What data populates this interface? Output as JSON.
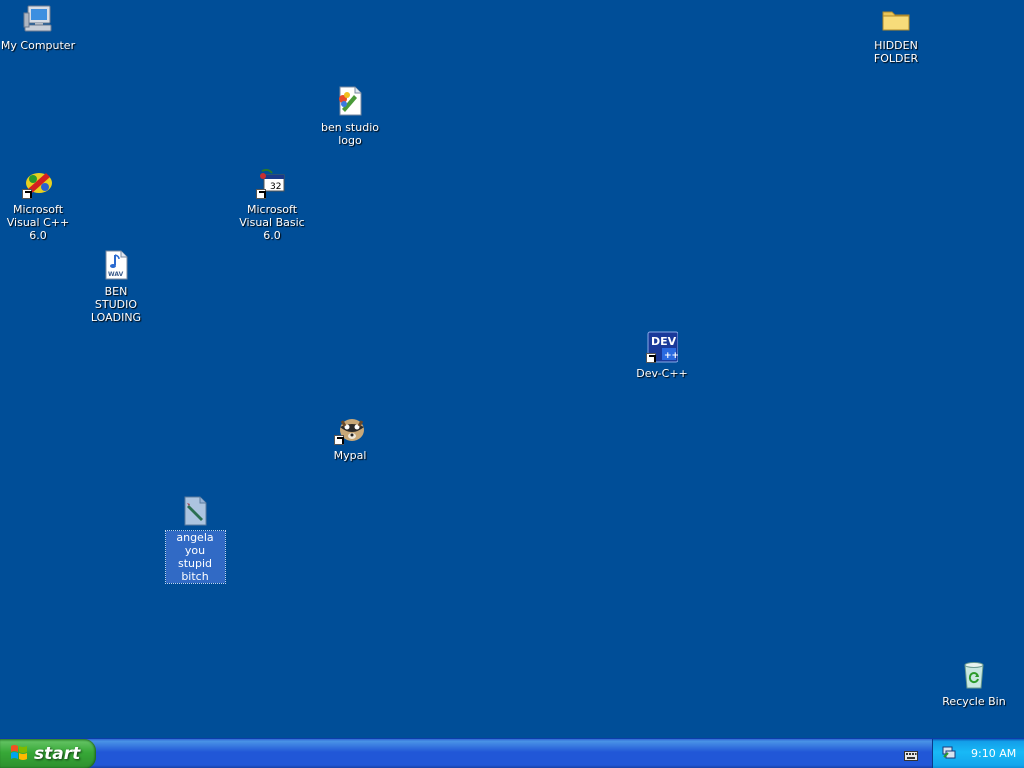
{
  "desktop": {
    "background_color": "#004e98",
    "icons": {
      "my_computer": {
        "label": "My Computer",
        "icon": "my-computer-icon"
      },
      "hidden_folder": {
        "label": "HIDDEN FOLDER",
        "icon": "folder-icon"
      },
      "ben_studio_logo": {
        "label": "ben studio logo",
        "icon": "paint-file-icon"
      },
      "visual_cpp": {
        "label": "Microsoft Visual C++ 6.0",
        "icon": "visual-cpp-icon"
      },
      "visual_basic": {
        "label": "Microsoft Visual Basic 6.0",
        "icon": "visual-basic-icon"
      },
      "ben_studio_loading": {
        "label": "BEN STUDIO LOADING",
        "icon": "wav-file-icon"
      },
      "dev_cpp": {
        "label": "Dev-C++",
        "icon": "dev-cpp-icon"
      },
      "mypal": {
        "label": "Mypal",
        "icon": "mypal-icon"
      },
      "angela": {
        "label": "angela you stupid bitch",
        "icon": "paint-file-icon"
      },
      "recycle_bin": {
        "label": "Recycle Bin",
        "icon": "recycle-bin-icon"
      }
    }
  },
  "taskbar": {
    "start_label": "start",
    "clock": "9:10 AM",
    "colors": {
      "taskbar": "#2157d7",
      "start": "#37a837",
      "tray": "#18b9f6"
    }
  }
}
